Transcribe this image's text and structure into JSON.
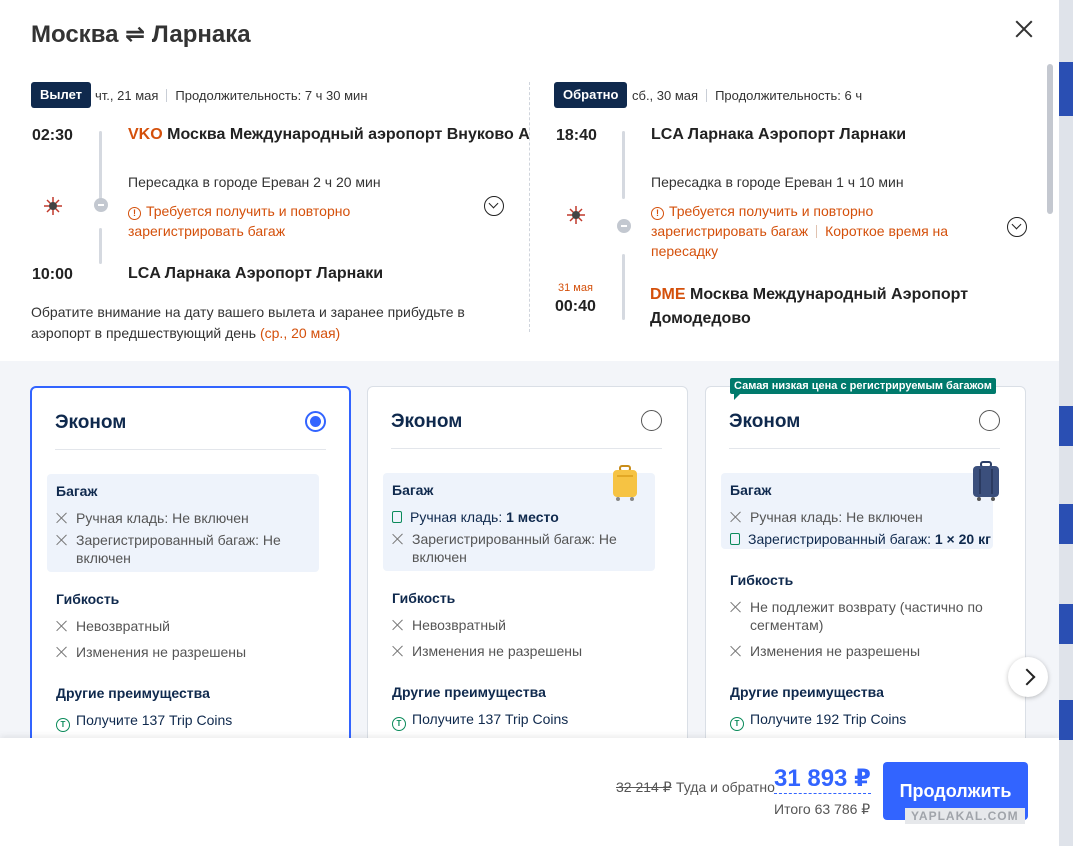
{
  "header": {
    "title": "Москва ⇌ Ларнака"
  },
  "outbound": {
    "tag": "Вылет",
    "date": "чт., 21 мая",
    "duration": "Продолжительность: 7 ч 30 мин",
    "dep_time": "02:30",
    "dep_code": "VKO",
    "dep_airport": "Москва Международный аэропорт Внуково А",
    "transfer": "Пересадка в городе Ереван  2 ч 20 мин",
    "warn1": "Требуется получить и повторно",
    "warn2": "зарегистрировать багаж",
    "arr_time": "10:00",
    "arr_airport": "LCA Ларнака Аэропорт Ларнаки",
    "note_text": "Обратите внимание на дату вашего вылета и заранее прибудьте в аэропорт в предшествующий день ",
    "note_date": "(ср., 20 мая)"
  },
  "return": {
    "tag": "Обратно",
    "date": "сб., 30 мая",
    "duration": "Продолжительность: 6 ч",
    "dep_time": "18:40",
    "dep_airport": "LCA Ларнака Аэропорт Ларнаки",
    "transfer": "Пересадка в городе Ереван  1 ч 10 мин",
    "warn1": "Требуется получить и повторно",
    "warn2": "зарегистрировать багаж",
    "warn3": "Короткое время на",
    "warn4": "пересадку",
    "arr_date": "31 мая",
    "arr_time": "00:40",
    "arr_code": "DME",
    "arr_airport1": "Москва Международный Аэропорт",
    "arr_airport2": "Домодедово"
  },
  "fares": [
    {
      "name": "Эконом",
      "selected": true,
      "baggage_title": "Багаж",
      "hand": "Ручная кладь: Не включен",
      "checked1": "Зарегистрированный багаж: Не",
      "checked2": "включен",
      "flex_title": "Гибкость",
      "flex1": "Невозвратный",
      "flex2": "Изменения не разрешены",
      "other_title": "Другие преимущества",
      "coins": "Получите 137 Trip Coins"
    },
    {
      "name": "Эконом",
      "selected": false,
      "baggage_title": "Багаж",
      "hand_label": "Ручная кладь: ",
      "hand_value": "1 место",
      "checked1": "Зарегистрированный багаж: Не",
      "checked2": "включен",
      "flex_title": "Гибкость",
      "flex1": "Невозвратный",
      "flex2": "Изменения не разрешены",
      "other_title": "Другие преимущества",
      "coins": "Получите 137 Trip Coins"
    },
    {
      "name": "Эконом",
      "selected": false,
      "badge": "Самая низкая цена с регистрируемым багажом",
      "baggage_title": "Багаж",
      "hand": "Ручная кладь: Не включен",
      "checked_label": "Зарегистрированный багаж: ",
      "checked_value": "1 × 20 кг",
      "flex_title": "Гибкость",
      "flex1a": "Не подлежит возврату (частично по",
      "flex1b": "сегментам)",
      "flex2": "Изменения не разрешены",
      "other_title": "Другие преимущества",
      "coins": "Получите 192 Trip Coins"
    }
  ],
  "footer": {
    "old_price": "32 214 ₽",
    "round_trip": "Туда и обратно",
    "price": "31 893 ₽",
    "total": "Итого 63 786 ₽",
    "continue_label": "Продолжить"
  },
  "watermark": "YAPLAKAL.COM",
  "colors": {
    "accent": "#3264ff",
    "warning": "#d4500b",
    "navy": "#0f294d",
    "badge": "#007a6c"
  }
}
